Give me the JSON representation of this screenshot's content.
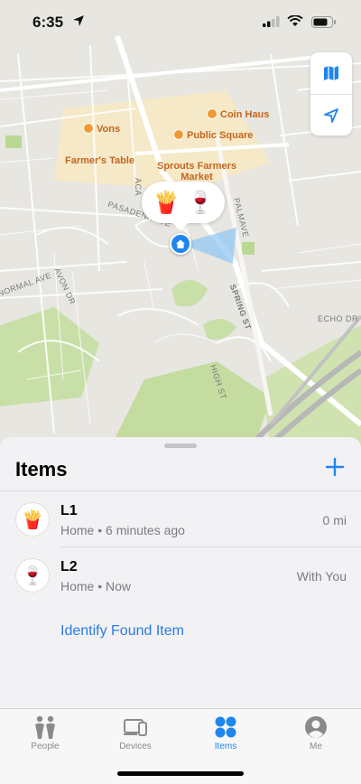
{
  "status": {
    "time": "6:35"
  },
  "map": {
    "pois": [
      {
        "label": "Vons"
      },
      {
        "label": "Coin Haus"
      },
      {
        "label": "Public Square"
      },
      {
        "label": "Farmer's Table"
      },
      {
        "label": "Sprouts Farmers Market"
      }
    ],
    "streets": [
      "PASADENA AVE",
      "ACA",
      "PALMAVE",
      "SPRING ST",
      "NORMAL AVE",
      "AVON DR",
      "ECHO DR",
      "HIGH ST"
    ],
    "bubble": [
      "🍟",
      "🍷"
    ]
  },
  "sheet": {
    "title": "Items",
    "items": [
      {
        "emoji": "🍟",
        "name": "L1",
        "subtitle": "Home • 6 minutes ago",
        "distance": "0 mi"
      },
      {
        "emoji": "🍷",
        "name": "L2",
        "subtitle": "Home • Now",
        "distance": "With You"
      }
    ],
    "identify_label": "Identify Found Item"
  },
  "tabbar": {
    "tabs": [
      {
        "label": "People",
        "icon": "people-icon",
        "active": false
      },
      {
        "label": "Devices",
        "icon": "devices-icon",
        "active": false
      },
      {
        "label": "Items",
        "icon": "items-icon",
        "active": true
      },
      {
        "label": "Me",
        "icon": "me-icon",
        "active": false
      }
    ]
  },
  "colors": {
    "accent": "#1f86ee",
    "poi": "#f09a37",
    "park": "#c9dfa8"
  }
}
